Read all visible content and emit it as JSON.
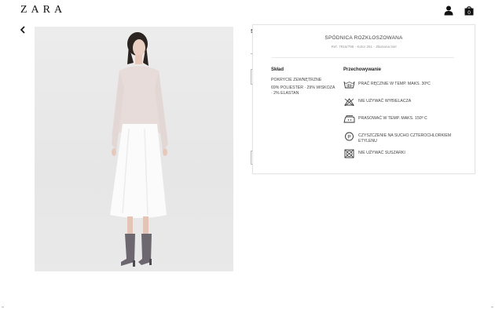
{
  "header": {
    "brand": "ZARA",
    "icons": {
      "account": "user-icon",
      "bag": "shopping-bag-icon",
      "back": "chevron-left-icon"
    },
    "bag_count": "0"
  },
  "underlying": {
    "title_initial": "S"
  },
  "panel": {
    "title": "SPÓDNICA ROZKLOSZOWANA",
    "ref": "Ref. 7916/799 · Kolor 251 - Złamana biel",
    "composition": {
      "heading": "Skład",
      "subheading": "POKRYCIE ZEWNĘTRZNE",
      "text": "69% POLIESTER · 29% WISKOZA · 2% ELASTAN"
    },
    "care": {
      "heading": "Przechowywanie",
      "items": [
        {
          "icon": "hand-wash-icon",
          "text": "PRAĆ RĘCZNIE W TEMP. MAKS. 30ºC"
        },
        {
          "icon": "no-bleach-icon",
          "text": "NIE UŻYWAĆ WYBIELACZA"
        },
        {
          "icon": "iron-icon",
          "text": "PRASOWAĆ W TEMP. MAKS. 150º C"
        },
        {
          "icon": "dry-clean-p-icon",
          "text": "CZYSZCZENIE NA SUCHO CZTEROCHLORKIEM ETYLENU"
        },
        {
          "icon": "no-tumble-dry-icon",
          "text": "NIE UŻYWAĆ SUSZARKI"
        }
      ]
    }
  },
  "colors": {
    "text": "#222222",
    "muted": "#999999",
    "photo_bg": "#e8e8e8",
    "border": "#e4e4e4"
  }
}
